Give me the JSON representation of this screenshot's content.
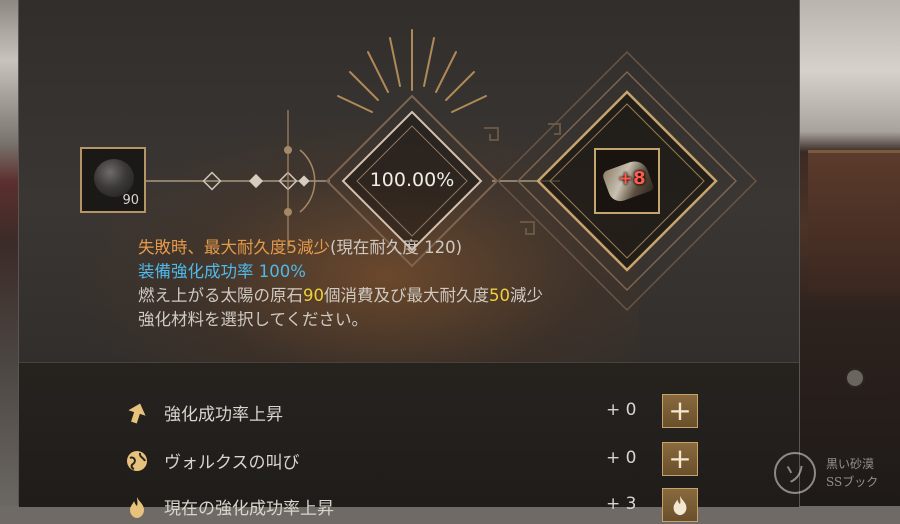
{
  "enhance": {
    "material_count": "90",
    "success_rate": "100.00%",
    "result_enhance_level": "+8"
  },
  "info": {
    "line1_main": "失敗時、最大耐久度5減少",
    "line1_current": "(現在耐久度 120)",
    "line2": "装備強化成功率 100%",
    "line3_a": "燃え上がる太陽の原石",
    "line3_b": "90",
    "line3_c": "個消費及び最大耐久度",
    "line3_d": "50",
    "line3_e": "減少",
    "line4": "強化材料を選択してください。"
  },
  "options": [
    {
      "label": "強化成功率上昇",
      "value": "+ 0",
      "icon": "arrow-up-icon"
    },
    {
      "label": "ヴォルクスの叫び",
      "value": "+ 0",
      "icon": "globe-icon"
    },
    {
      "label": "現在の強化成功率上昇",
      "value": "+ 3",
      "icon": "flame-icon"
    }
  ],
  "watermark": {
    "line1": "黒い砂漠",
    "line2": "SSブック"
  },
  "colors": {
    "accent_gold": "#c6a46d",
    "text_orange": "#e59a4a",
    "text_blue": "#4fb9ea",
    "text_yellow": "#f0cf3c"
  }
}
